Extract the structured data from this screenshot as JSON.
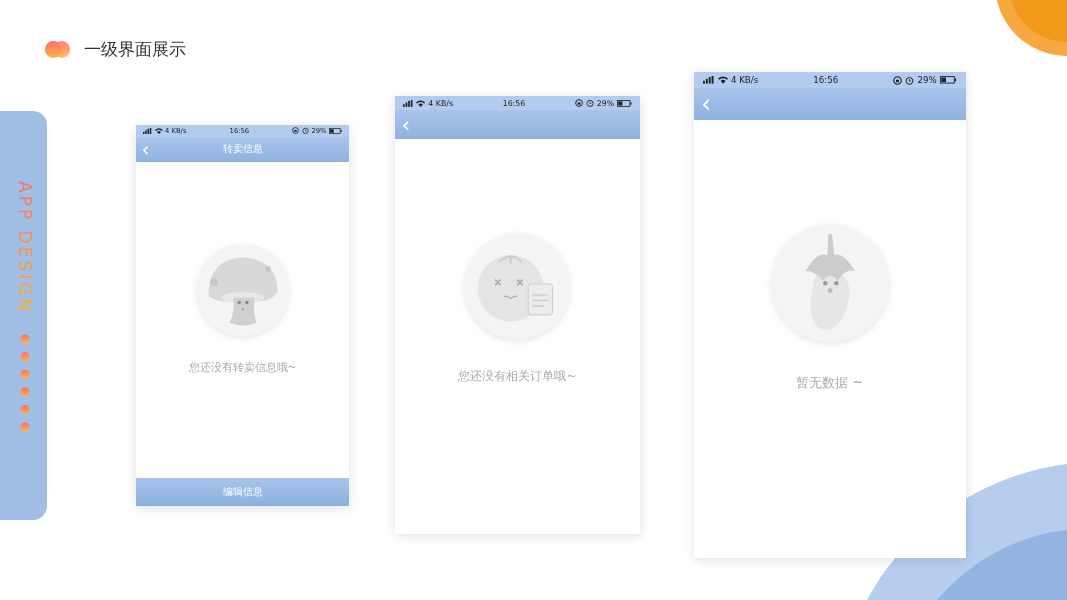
{
  "heading": "一级界面展示",
  "side_label": "APP DESIGN",
  "phones": [
    {
      "status": {
        "speed": "4 KB/s",
        "time": "16:56",
        "battery": "29%"
      },
      "title": "转卖信息",
      "back": "‹",
      "kind": "mushroom",
      "message": "您还没有转卖信息哦~",
      "bottom_button": "编辑信息"
    },
    {
      "status": {
        "speed": "4 KB/s",
        "time": "16:56",
        "battery": "29%"
      },
      "back": "‹",
      "kind": "tomato",
      "message": "您还没有相关订单哦~"
    },
    {
      "status": {
        "speed": "4 KB/s",
        "time": "16:56",
        "battery": "29%"
      },
      "back": "‹",
      "kind": "eggplant",
      "message": "暂无数据 ~"
    }
  ]
}
